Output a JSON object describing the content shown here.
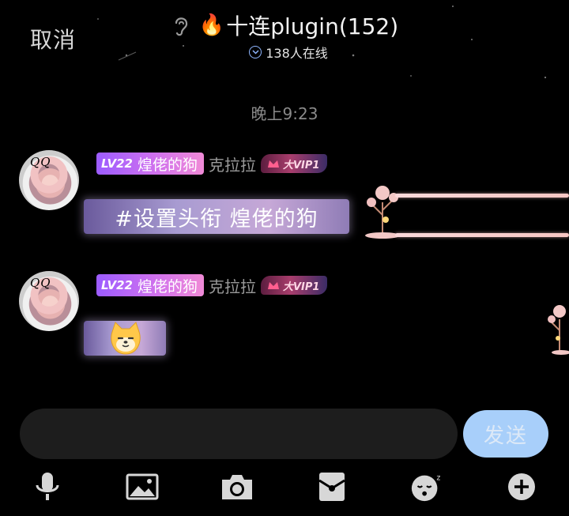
{
  "header": {
    "cancel_label": "取消",
    "group_name": "十连plugin(152)",
    "online_count": "138人在线"
  },
  "timestamp": "晚上9:23",
  "messages": [
    {
      "avatar_text": "QQ",
      "level": "LV22",
      "title_badge": "煌佬的狗",
      "nickname": "克拉拉",
      "vip": "大VIP1",
      "text": "#设置头衔 煌佬的狗"
    },
    {
      "avatar_text": "QQ",
      "level": "LV22",
      "title_badge": "煌佬的狗",
      "nickname": "克拉拉",
      "vip": "大VIP1",
      "text": ""
    }
  ],
  "composer": {
    "input_value": "",
    "send_label": "发送"
  },
  "toolbar": {
    "icons": [
      "microphone-icon",
      "image-icon",
      "camera-icon",
      "red-packet-icon",
      "emoji-icon",
      "plus-icon"
    ]
  },
  "colors": {
    "background": "#000000",
    "send_button": "#a8cffa",
    "title_badge_start": "#9c5cff",
    "title_badge_end": "#f08ad6",
    "bubble": "#a89bd1"
  }
}
